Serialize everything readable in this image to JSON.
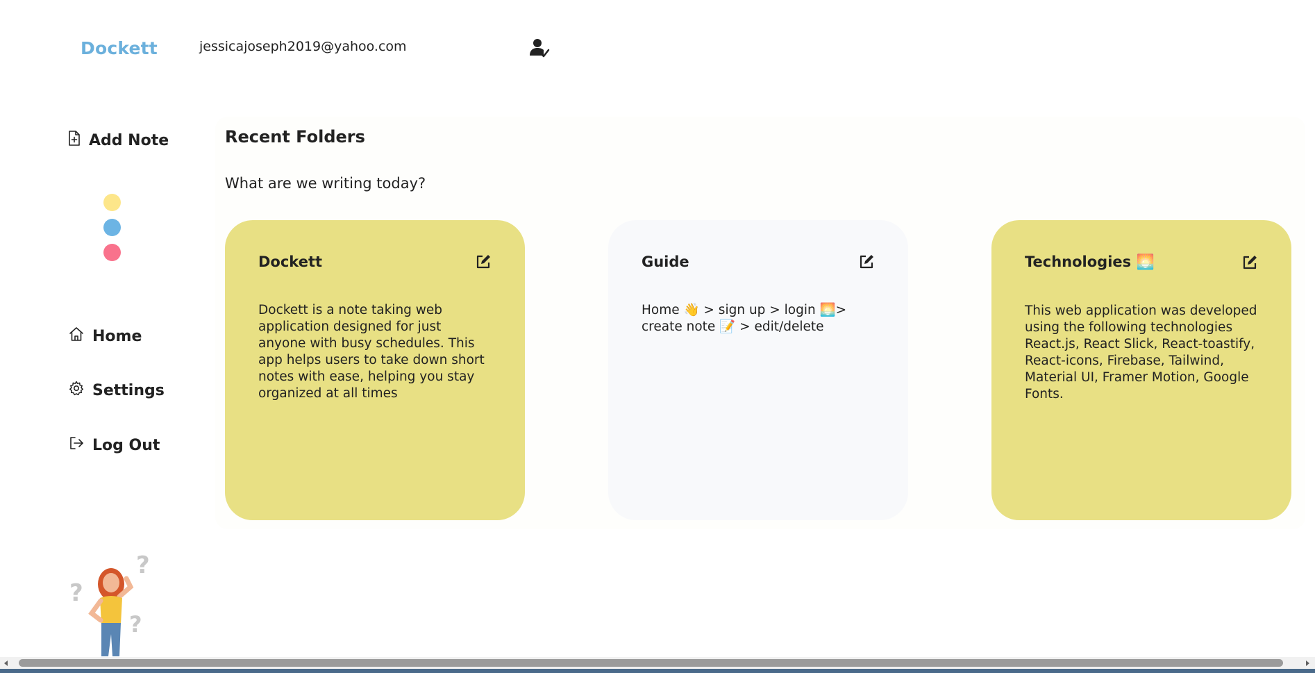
{
  "header": {
    "logo": "Dockett",
    "user_email": "jessicajoseph2019@yahoo.com",
    "user_icon": "user-check-icon"
  },
  "sidebar": {
    "add_note_label": "Add Note",
    "add_note_icon": "file-plus-icon",
    "color_dots": [
      {
        "name": "yellow",
        "color": "#fde68a"
      },
      {
        "name": "blue",
        "color": "#6cb4e4"
      },
      {
        "name": "pink",
        "color": "#f9728c"
      }
    ],
    "nav": [
      {
        "label": "Home",
        "icon": "home-icon"
      },
      {
        "label": "Settings",
        "icon": "gear-icon"
      },
      {
        "label": "Log Out",
        "icon": "logout-icon"
      }
    ]
  },
  "main": {
    "title": "Recent Folders",
    "subtitle": "What are we writing today?",
    "cards": [
      {
        "title": "Dockett",
        "body": "Dockett is a note taking web application designed for just anyone with busy schedules. This app helps users to take down short notes with ease, helping you stay organized at all times",
        "bg": "#e8e084"
      },
      {
        "title": "Guide",
        "body": "Home 👋 > sign up > login 🌅>\ncreate note 📝 > edit/delete",
        "bg": "#f8f9fb"
      },
      {
        "title": "Technologies 🌅",
        "body": "This web application was developed using the following technologies React.js, React Slick, React-toastify, React-icons, Firebase, Tailwind, Material UI, Framer Motion, Google Fonts.",
        "bg": "#e8e084"
      }
    ]
  },
  "colors": {
    "accent": "#6bb0dc",
    "card_yellow": "#e8e084",
    "card_light": "#f8f9fb"
  }
}
